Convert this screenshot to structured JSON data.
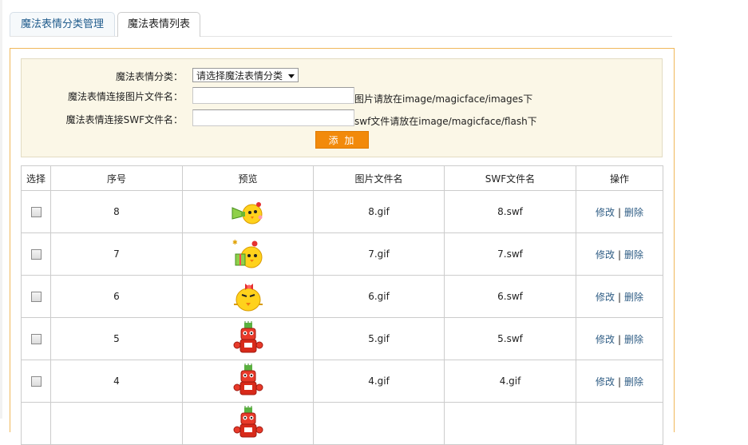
{
  "tabs": [
    {
      "label": "魔法表情分类管理",
      "active": false
    },
    {
      "label": "魔法表情列表",
      "active": true
    }
  ],
  "form": {
    "category_label": "魔法表情分类：",
    "category_select": "请选择魔法表情分类",
    "image_label": "魔法表情连接图片文件名：",
    "image_hint": "图片请放在image/magicface/images下",
    "swf_label": "魔法表情连接SWF文件名：",
    "swf_hint": "swf文件请放在image/magicface/flash下",
    "add_button": "添 加"
  },
  "table": {
    "headers": [
      "选择",
      "序号",
      "预览",
      "图片文件名",
      "SWF文件名",
      "操作"
    ],
    "edit_label": "修改",
    "separator": "|",
    "delete_label": "删除",
    "rows": [
      {
        "id": "8",
        "image": "8.gif",
        "swf": "8.swf",
        "preview": "chick-trumpet-icon"
      },
      {
        "id": "7",
        "image": "7.gif",
        "swf": "7.swf",
        "preview": "chick-gift-icon"
      },
      {
        "id": "6",
        "image": "6.gif",
        "swf": "6.swf",
        "preview": "chick-bow-icon"
      },
      {
        "id": "5",
        "image": "5.gif",
        "swf": "5.swf",
        "preview": "red-robot-icon"
      },
      {
        "id": "4",
        "image": "4.gif",
        "swf": "4.gif",
        "preview": "red-robot-icon"
      }
    ]
  },
  "colors": {
    "accent": "#f28a0b",
    "link": "#2e5c84",
    "form_bg": "#fbf7e7",
    "panel_border": "#f0b85a"
  }
}
